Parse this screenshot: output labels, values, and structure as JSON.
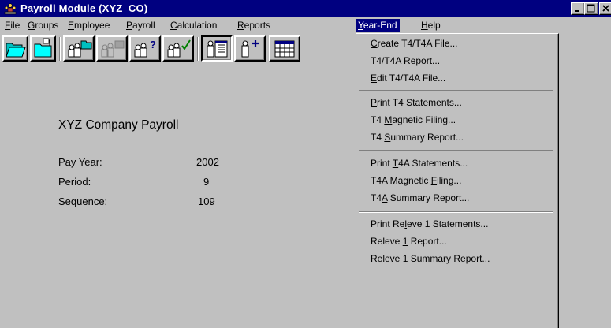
{
  "window": {
    "title": "Payroll Module  (XYZ_CO)"
  },
  "menubar": [
    {
      "pre": "",
      "u": "F",
      "post": "ile"
    },
    {
      "pre": "",
      "u": "G",
      "post": "roups"
    },
    {
      "pre": "",
      "u": "E",
      "post": "mployee"
    },
    {
      "pre": "",
      "u": "P",
      "post": "ayroll"
    },
    {
      "pre": "",
      "u": "C",
      "post": "alculation"
    },
    {
      "pre": "",
      "u": "R",
      "post": "eports"
    },
    {
      "pre": "",
      "u": "Y",
      "post": "ear-End"
    },
    {
      "pre": "",
      "u": "H",
      "post": "elp"
    }
  ],
  "toolbar": {
    "icons": [
      "open-folder-icon",
      "new-folder-icon",
      "group-folder-icon",
      "group-disabled-icon",
      "group-query-icon",
      "group-check-icon",
      "employee-document-icon",
      "add-employee-icon",
      "calculator-grid-icon"
    ]
  },
  "company": {
    "name": "XYZ Company Payroll",
    "pay_year_label": "Pay Year:",
    "pay_year": "2002",
    "period_label": "Period:",
    "period": "9",
    "sequence_label": "Sequence:",
    "sequence": "109"
  },
  "yearend_menu": [
    {
      "pre": "",
      "u": "C",
      "post": "reate T4/T4A File..."
    },
    {
      "pre": "T4/T4A ",
      "u": "R",
      "post": "eport..."
    },
    {
      "pre": "",
      "u": "E",
      "post": "dit T4/T4A File..."
    },
    {
      "pre": "",
      "u": "P",
      "post": "rint T4 Statements..."
    },
    {
      "pre": "T4 ",
      "u": "M",
      "post": "agnetic Filing..."
    },
    {
      "pre": "T4 ",
      "u": "S",
      "post": "ummary Report..."
    },
    {
      "pre": "Print ",
      "u": "T",
      "post": "4A Statements..."
    },
    {
      "pre": "T4A Magnetic ",
      "u": "F",
      "post": "iling..."
    },
    {
      "pre": "T4",
      "u": "A",
      "post": " Summary Report..."
    },
    {
      "pre": "Print Re",
      "u": "l",
      "post": "eve 1 Statements..."
    },
    {
      "pre": "Releve ",
      "u": "1",
      "post": " Report..."
    },
    {
      "pre": "Releve 1 S",
      "u": "u",
      "post": "mmary Report..."
    }
  ]
}
